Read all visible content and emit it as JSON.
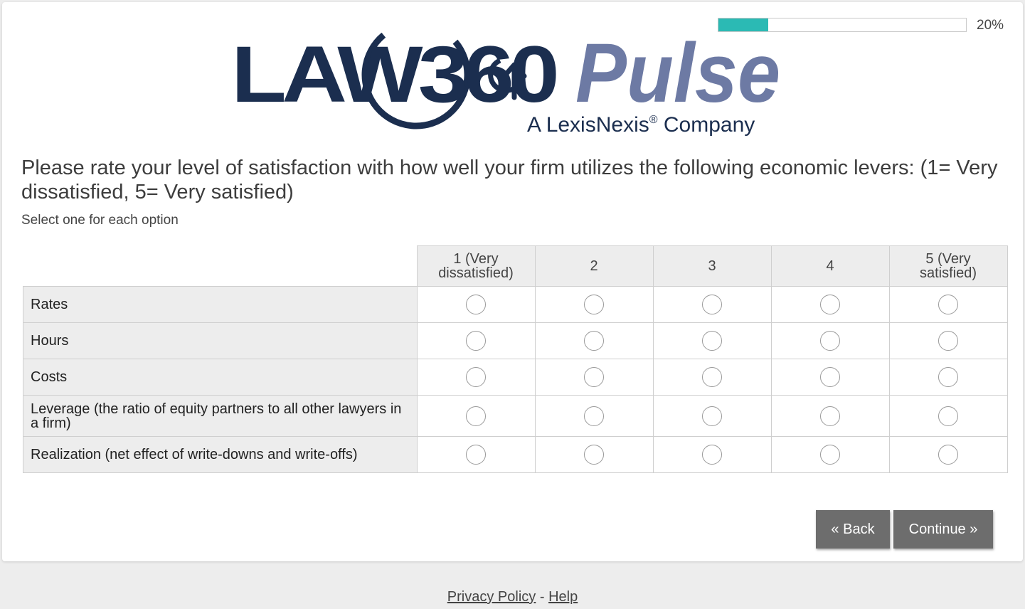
{
  "progress": {
    "value": 0.2,
    "text": "20%"
  },
  "logo": {
    "brand_main": "LAW360",
    "brand_pulse": "Pulse",
    "tagline_prefix": "A LexisNexis",
    "tagline_reg": "®",
    "tagline_suffix": " Company"
  },
  "question": {
    "text": "Please rate your level of satisfaction with how well your firm utilizes the following economic levers: (1= Very dissatisfied, 5= Very satisfied)",
    "instruction": "Select one for each option"
  },
  "matrix": {
    "columns": [
      "1 (Very dissatisfied)",
      "2",
      "3",
      "4",
      "5 (Very satisfied)"
    ],
    "rows": [
      "Rates",
      "Hours",
      "Costs",
      "Leverage (the ratio of equity partners to all other lawyers in a firm)",
      "Realization (net effect of write-downs and write-offs)"
    ]
  },
  "buttons": {
    "back": "« Back",
    "continue": "Continue »"
  },
  "footer": {
    "privacy": "Privacy Policy",
    "separator": " - ",
    "help": "Help"
  },
  "colors": {
    "progress_fill": "#2bbab4",
    "logo_navy": "#1b2e4f",
    "logo_pulse": "#6d7aa4",
    "button_bg": "#6d6d6d"
  }
}
